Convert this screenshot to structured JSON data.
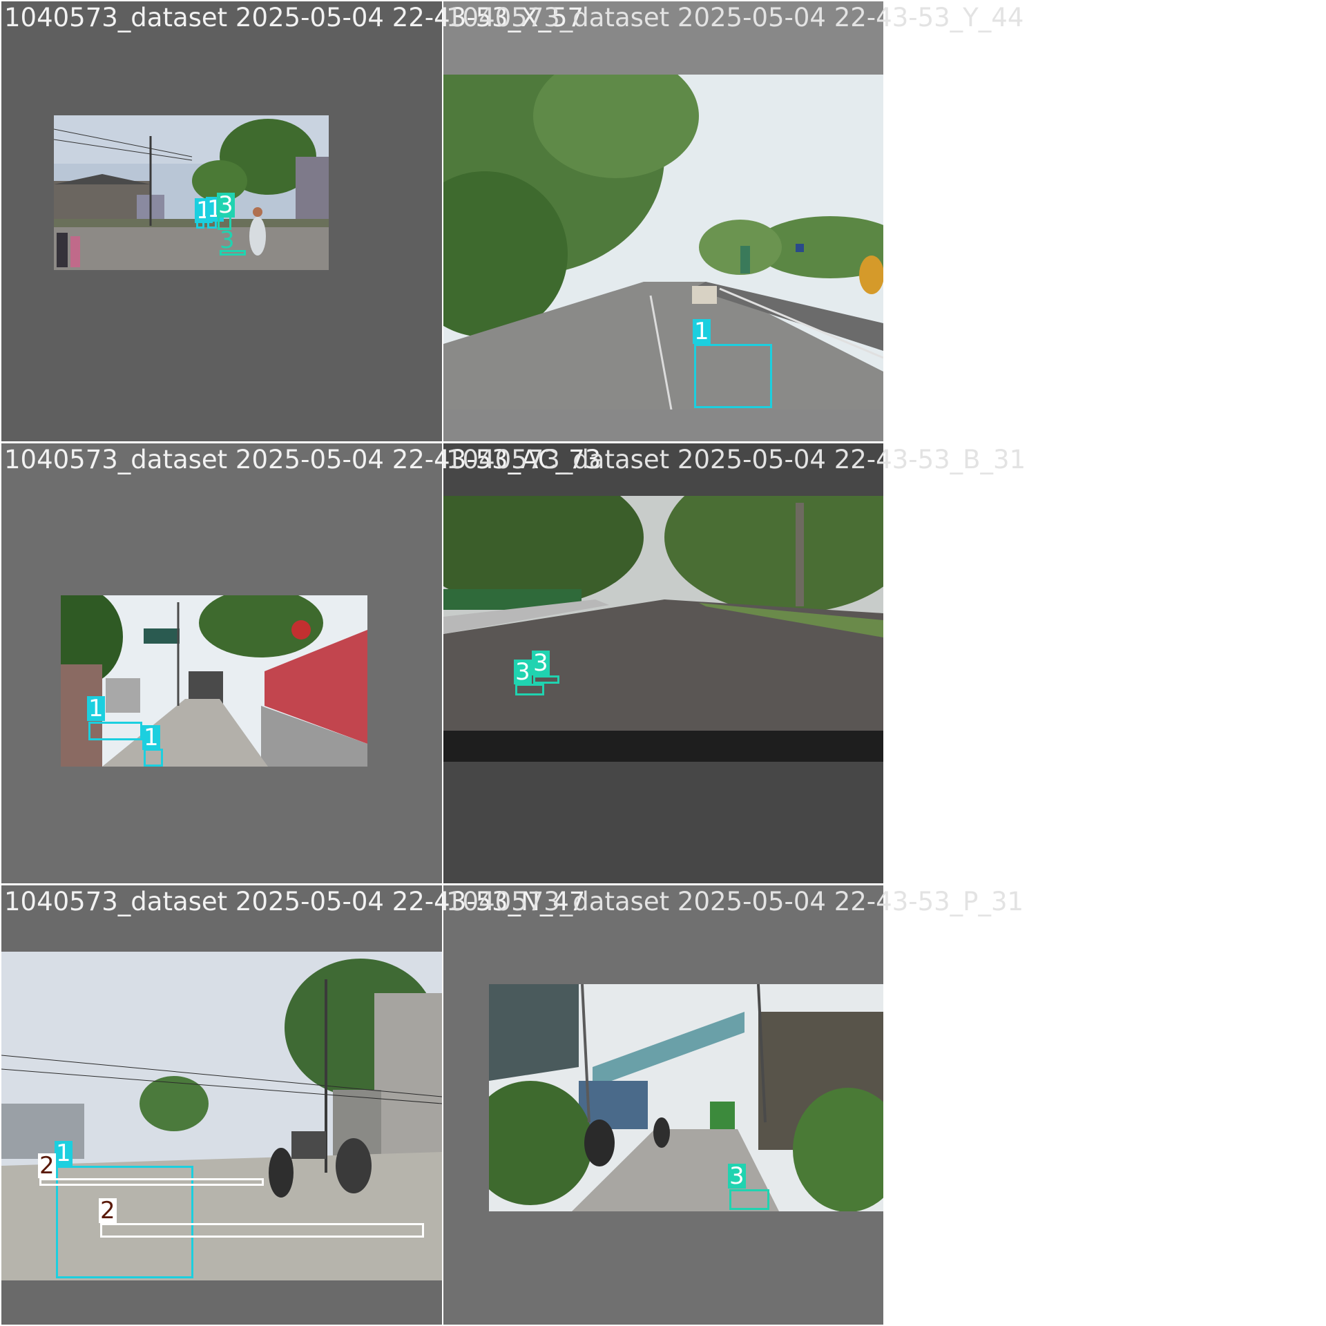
{
  "tiles": [
    {
      "caption_main": "1040573_dataset 2025-05-04 22-43-53",
      "caption_tail": "_X_57",
      "bg": "#5f5f5f"
    },
    {
      "caption_main": "1040573_dataset 2025-05-04 22-43-53",
      "caption_tail": "_Y_44",
      "bg": "#888888"
    },
    {
      "caption_main": "1040573_dataset 2025-05-04 22-43-53",
      "caption_tail": "_AC_73",
      "bg": "#6e6e6e"
    },
    {
      "caption_main": "1040573_dataset 2025-05-04 22-43-53",
      "caption_tail": "_B_31",
      "bg": "#474747"
    },
    {
      "caption_main": "1040573_dataset 2025-05-04 22-43-53",
      "caption_tail": "_N_47",
      "bg": "#6a6a6a"
    },
    {
      "caption_main": "1040573_dataset 2025-05-04 22-43-53",
      "caption_tail": "_P_31",
      "bg": "#707070"
    }
  ],
  "labels": {
    "t1": [
      "1",
      "1",
      "3",
      "3"
    ],
    "t2": [
      "1"
    ],
    "t3": [
      "1",
      "1"
    ],
    "t4": [
      "3",
      "3"
    ],
    "t5": [
      "1",
      "2",
      "2"
    ],
    "t6": [
      "3"
    ]
  },
  "colors": {
    "class_1": "#1ccfdf",
    "class_2": "#ffffff",
    "class_3": "#20d3b0"
  }
}
